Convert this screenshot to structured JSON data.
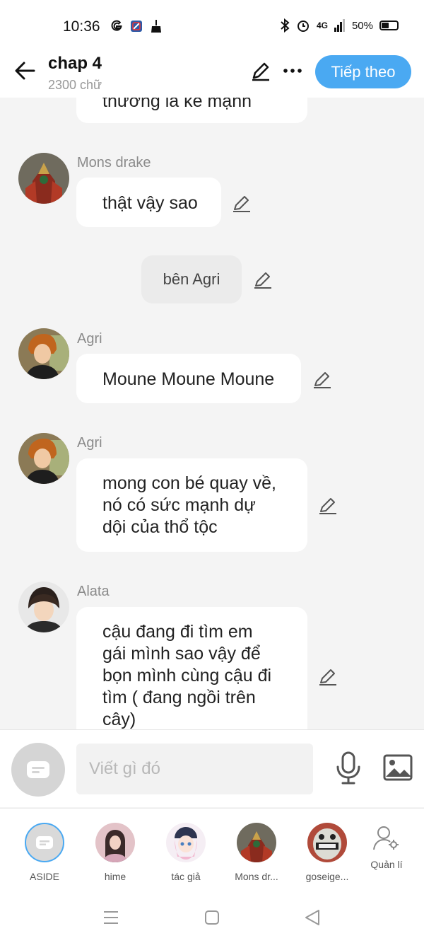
{
  "status": {
    "time": "10:36",
    "net": "4G",
    "battery": "50%"
  },
  "header": {
    "title": "chap 4",
    "word_count": "2300 chữ",
    "next_label": "Tiếp theo"
  },
  "messages": {
    "partial_text": "thường là kẻ mạnh",
    "m1": {
      "sender": "Mons drake",
      "text": "thật vậy sao"
    },
    "narration": "bên Agri",
    "m2": {
      "sender": "Agri",
      "text": "Moune Moune Moune"
    },
    "m3": {
      "sender": "Agri",
      "lines": [
        "mong con bé quay về,",
        "nó có sức mạnh dự",
        "dội của thổ tộc"
      ]
    },
    "m4": {
      "sender": "Alata",
      "lines": [
        "cậu đang đi tìm em",
        "gái mình sao vậy để",
        "bọn mình cùng cậu đi",
        "tìm ( đang ngồi trên",
        "cây)"
      ]
    }
  },
  "composer": {
    "placeholder": "Viết gì đó"
  },
  "characters": [
    {
      "label": "ASIDE"
    },
    {
      "label": "hime"
    },
    {
      "label": "tác giả"
    },
    {
      "label": "Mons dr..."
    },
    {
      "label": "goseige..."
    },
    {
      "label": "Quản lí"
    }
  ],
  "colors": {
    "accent": "#4aa9f2",
    "background": "#f4f4f4",
    "bubble": "#ffffff"
  }
}
